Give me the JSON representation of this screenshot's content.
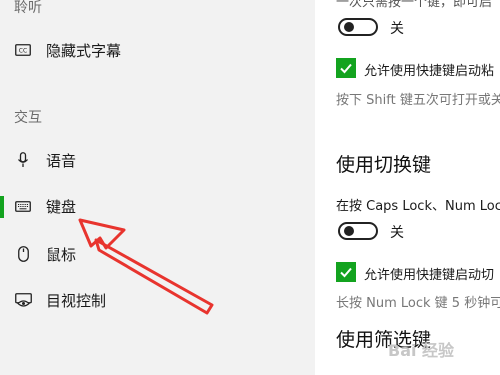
{
  "sidebar": {
    "section_hearing": "聆听",
    "section_interaction": "交互",
    "items": [
      {
        "label": "隐藏式字幕",
        "icon": "closed-captions-icon"
      },
      {
        "label": "语音",
        "icon": "microphone-icon"
      },
      {
        "label": "键盘",
        "icon": "keyboard-icon",
        "selected": true
      },
      {
        "label": "鼠标",
        "icon": "mouse-icon"
      },
      {
        "label": "目视控制",
        "icon": "eye-control-icon"
      }
    ]
  },
  "main": {
    "top_partial_text": "一次只需按一个键，即可启",
    "toggle1_state": "关",
    "check1_label": "允许使用快捷键启动粘",
    "hint1": "按下 Shift 键五次可打开或关",
    "toggle_keys_heading": "使用切换键",
    "toggle_keys_desc": "在按 Caps Lock、Num Lock",
    "toggle2_state": "关",
    "check2_label": "允许使用快捷键启动切",
    "hint2": "长按 Num Lock 键 5 秒钟可",
    "filter_keys_heading": "使用筛选键"
  },
  "colors": {
    "accent": "#13a31f",
    "annotation_arrow": "#e8342e",
    "sidebar_bg": "#f2f2f2"
  },
  "watermark": "Bai 经验"
}
